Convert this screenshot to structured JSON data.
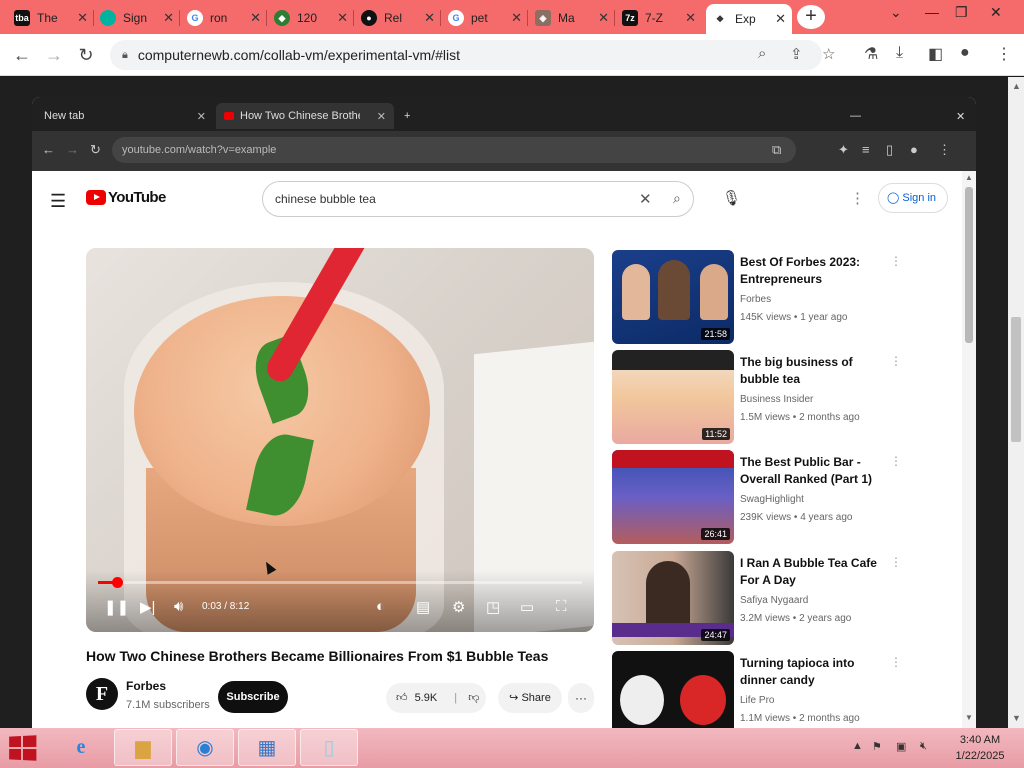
{
  "outer_browser": {
    "tabs": [
      {
        "label": "The",
        "icon": "tba-icon",
        "color": "#111111"
      },
      {
        "label": "Sign",
        "icon": "circle-logo-icon",
        "color": "#00b3a0"
      },
      {
        "label": "ron",
        "icon": "google-icon",
        "color": "#4285f4"
      },
      {
        "label": "120",
        "icon": "shield-icon",
        "color": "#2e7d32"
      },
      {
        "label": "Rel",
        "icon": "github-icon",
        "color": "#111111"
      },
      {
        "label": "pet",
        "icon": "google-icon",
        "color": "#4285f4"
      },
      {
        "label": "Ma",
        "icon": "map-icon",
        "color": "#8d6e63"
      },
      {
        "label": "7-Z",
        "icon": "7zip-icon",
        "color": "#111111"
      },
      {
        "label": "Exp",
        "icon": "collab-icon",
        "color": "#333333",
        "active": true
      }
    ],
    "url": "computernewb.com/collab-vm/experimental-vm/#list"
  },
  "inner_browser": {
    "tabs": [
      {
        "label": "New tab"
      },
      {
        "label": "How Two Chinese Brothers..."
      }
    ],
    "url": "youtube.com/watch?v=example"
  },
  "youtube": {
    "logo_text": "YouTube",
    "search_query": "chinese bubble tea",
    "sign_in": "Sign in",
    "video": {
      "title": "How Two Chinese Brothers Became Billionaires From $1 Bubble Teas",
      "time": "0:03 / 8:12",
      "progress": 0.04,
      "channel": "Forbes",
      "channel_initial": "F",
      "subscribers": "7.1M subscribers",
      "subscribe": "Subscribe",
      "likes": "5.9K",
      "share": "Share",
      "more": "···"
    },
    "recommendations": [
      {
        "title": "Best Of Forbes 2023: Entrepreneurs",
        "channel": "Forbes",
        "meta": "145K views • 1 year ago",
        "duration": "21:58"
      },
      {
        "title": "The big business of bubble tea",
        "channel": "Business Insider",
        "meta": "1.5M views • 2 months ago",
        "duration": "11:52"
      },
      {
        "title": "The Best Public Bar - Overall Ranked (Part 1)",
        "channel": "SwagHighlight",
        "meta": "239K views • 4 years ago",
        "duration": "26:41"
      },
      {
        "title": "I Ran A Bubble Tea Cafe For A Day",
        "channel": "Safiya Nygaard",
        "meta": "3.2M views • 2 years ago",
        "duration": "24:47"
      },
      {
        "title": "Turning tapioca into dinner candy",
        "channel": "Life Pro",
        "meta": "1.1M views • 2 months ago",
        "duration": ""
      }
    ]
  },
  "taskbar": {
    "time": "3:40 AM",
    "date": "1/22/2025"
  },
  "colors": {
    "tab_bar": "#f56b6b",
    "youtube_red": "#e00000",
    "taskbar": "#eea8b0"
  }
}
